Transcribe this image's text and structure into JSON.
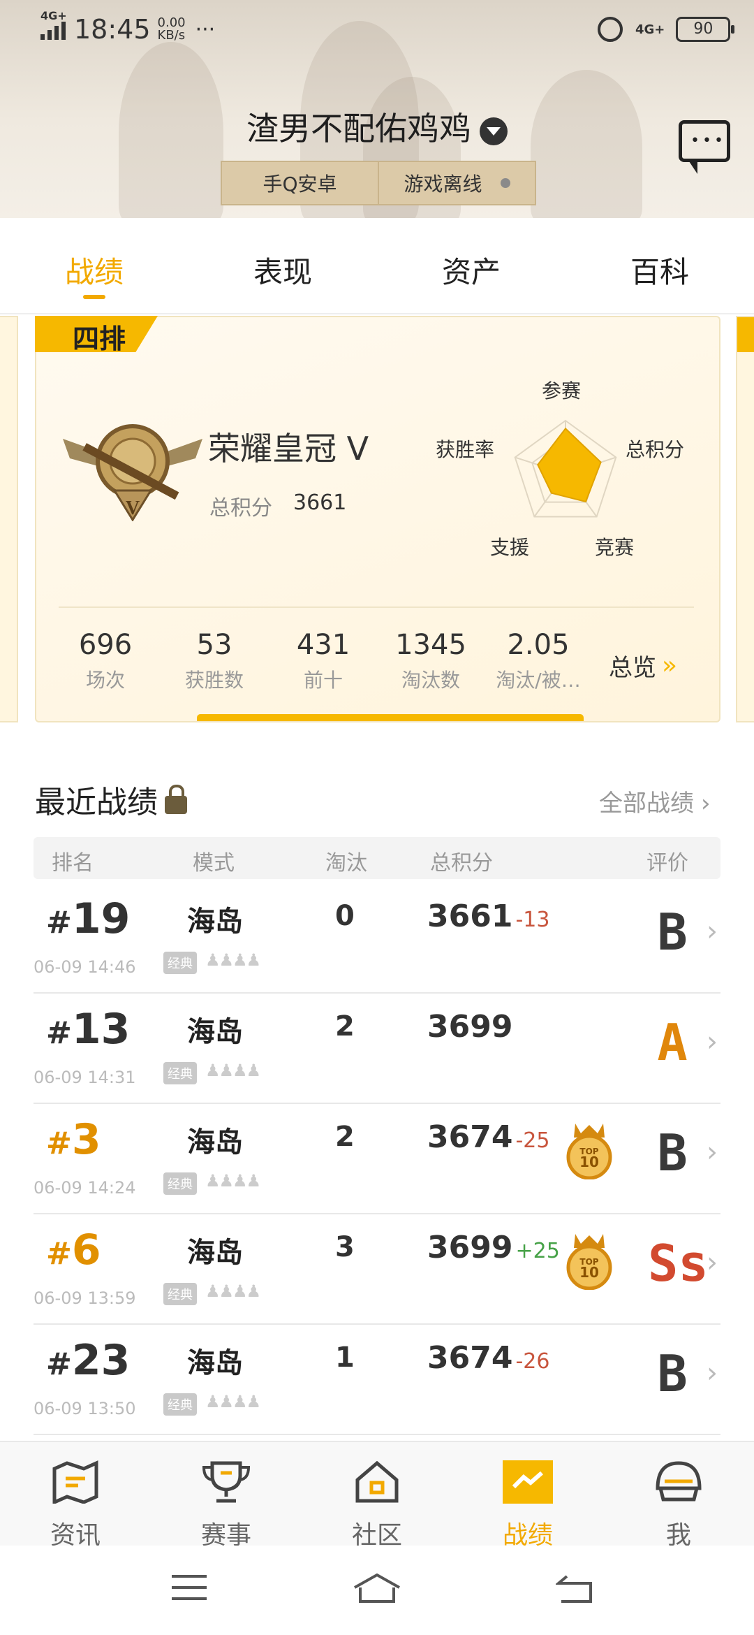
{
  "status_bar": {
    "network": "4G+",
    "time": "18:45",
    "speed_value": "0.00",
    "speed_unit": "KB/s",
    "more": "···",
    "network_right": "4G+",
    "battery": "90"
  },
  "header": {
    "nickname": "渣男不配佑鸡鸡",
    "platform": "手Q安卓",
    "game_status": "游戏离线"
  },
  "tabs": [
    "战绩",
    "表现",
    "资产",
    "百科"
  ],
  "active_tab": "战绩",
  "rank_card": {
    "mode": "四排",
    "rank_name": "荣耀皇冠 V",
    "score_label": "总积分",
    "score_value": "3661",
    "radar": {
      "labels": [
        "参赛",
        "总积分",
        "竞赛",
        "支援",
        "获胜率"
      ],
      "values": [
        0.85,
        0.7,
        0.65,
        0.45,
        0.55
      ]
    },
    "stats": [
      {
        "value": "696",
        "label": "场次"
      },
      {
        "value": "53",
        "label": "获胜数"
      },
      {
        "value": "431",
        "label": "前十"
      },
      {
        "value": "1345",
        "label": "淘汰数"
      },
      {
        "value": "2.05",
        "label": "淘汰/被…"
      }
    ],
    "overview_label": "总览"
  },
  "recent": {
    "title": "最近战绩",
    "all_link": "全部战绩",
    "columns": [
      "排名",
      "模式",
      "淘汰",
      "总积分",
      "评价"
    ],
    "rows": [
      {
        "rank": "19",
        "time": "06-09 14:46",
        "map": "海岛",
        "tag": "经典",
        "kills": "0",
        "score": "3661",
        "delta": "-13",
        "delta_sign": "neg",
        "top10": false,
        "grade": "B",
        "grade_color": "#3a3a3a"
      },
      {
        "rank": "13",
        "time": "06-09 14:31",
        "map": "海岛",
        "tag": "经典",
        "kills": "2",
        "score": "3699",
        "delta": "",
        "delta_sign": "",
        "top10": false,
        "grade": "A",
        "grade_color": "#e0870b"
      },
      {
        "rank": "3",
        "time": "06-09 14:24",
        "map": "海岛",
        "tag": "经典",
        "kills": "2",
        "score": "3674",
        "delta": "-25",
        "delta_sign": "neg",
        "top10": true,
        "grade": "B",
        "grade_color": "#3a3a3a"
      },
      {
        "rank": "6",
        "time": "06-09 13:59",
        "map": "海岛",
        "tag": "经典",
        "kills": "3",
        "score": "3699",
        "delta": "+25",
        "delta_sign": "pos",
        "top10": true,
        "grade": "Ss",
        "grade_color": "#d24a2f"
      },
      {
        "rank": "23",
        "time": "06-09 13:50",
        "map": "海岛",
        "tag": "经典",
        "kills": "1",
        "score": "3674",
        "delta": "-26",
        "delta_sign": "neg",
        "top10": false,
        "grade": "B",
        "grade_color": "#3a3a3a"
      }
    ],
    "top10_text": "TOP 10"
  },
  "bottom_nav": [
    {
      "label": "资讯",
      "icon": "news-map-icon"
    },
    {
      "label": "赛事",
      "icon": "trophy-icon"
    },
    {
      "label": "社区",
      "icon": "community-house-icon"
    },
    {
      "label": "战绩",
      "icon": "stats-chart-icon"
    },
    {
      "label": "我",
      "icon": "helmet-icon"
    }
  ],
  "colors": {
    "accent": "#f2a900",
    "ribbon": "#f6b800",
    "negative": "#c8553d",
    "positive": "#47a248"
  }
}
